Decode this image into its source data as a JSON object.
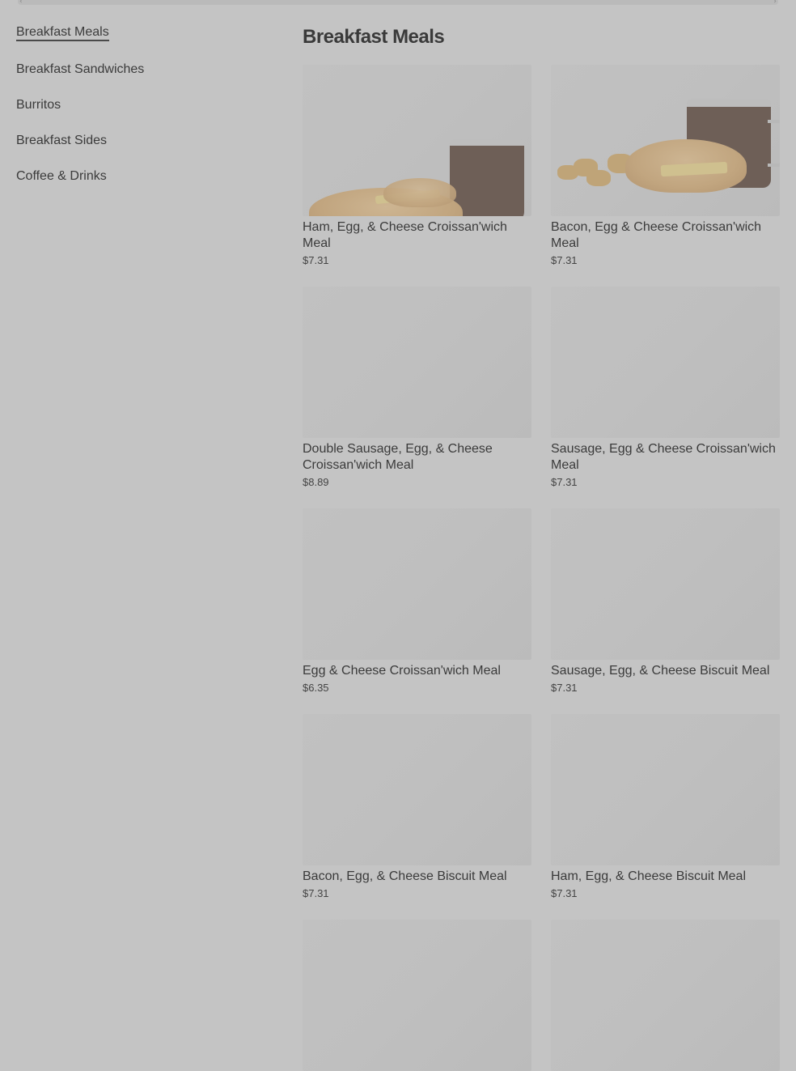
{
  "sidebar": {
    "items": [
      {
        "label": "Breakfast Meals",
        "active": true
      },
      {
        "label": "Breakfast Sandwiches"
      },
      {
        "label": "Burritos"
      },
      {
        "label": "Breakfast Sides"
      },
      {
        "label": "Coffee & Drinks"
      }
    ]
  },
  "main": {
    "title": "Breakfast Meals",
    "items": [
      {
        "name": "Ham, Egg, & Cheese Croissan'wich Meal",
        "price": "$7.31",
        "image": "croissant-meal"
      },
      {
        "name": "Bacon, Egg & Cheese Croissan'wich Meal",
        "price": "$7.31",
        "image": "croissant-meal-hashbrowns"
      },
      {
        "name": "Double Sausage, Egg, & Cheese Croissan'wich Meal",
        "price": "$8.89",
        "image": "placeholder"
      },
      {
        "name": "Sausage, Egg & Cheese Croissan'wich Meal",
        "price": "$7.31",
        "image": "placeholder"
      },
      {
        "name": "Egg & Cheese Croissan'wich Meal",
        "price": "$6.35",
        "image": "placeholder"
      },
      {
        "name": "Sausage, Egg, & Cheese Biscuit Meal",
        "price": "$7.31",
        "image": "placeholder"
      },
      {
        "name": "Bacon, Egg, & Cheese Biscuit Meal",
        "price": "$7.31",
        "image": "placeholder"
      },
      {
        "name": "Ham, Egg, & Cheese Biscuit Meal",
        "price": "$7.31",
        "image": "placeholder"
      }
    ]
  },
  "colors": {
    "overlay_background": "#c4c4c4",
    "text": "#3a3a3a",
    "image_placeholder": "#bfbfbf"
  }
}
